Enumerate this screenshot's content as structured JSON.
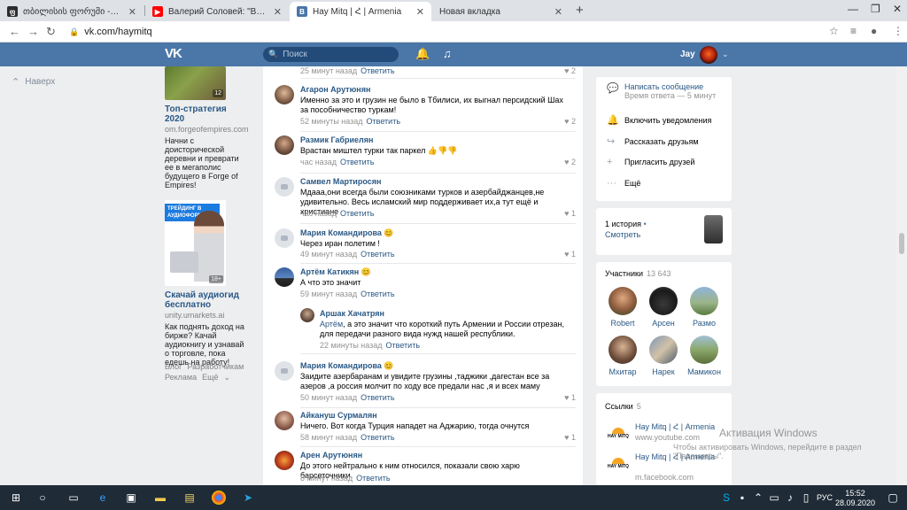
{
  "browser": {
    "tabs": [
      {
        "title": "თბილისის ფორუმი -> Quoti",
        "favicon_color": "#2c2c2c"
      },
      {
        "title": "Валерий Соловей: \"Власть боит",
        "favicon_color": "#ff0000"
      },
      {
        "title": "Hay Mitq | Հ | Armenia",
        "favicon_color": "#4a76a8"
      },
      {
        "title": "Новая вкладка",
        "favicon_color": "#ffffff"
      }
    ],
    "url": "vk.com/haymitq"
  },
  "header": {
    "search_placeholder": "Поиск",
    "username": "Jay"
  },
  "left": {
    "back_label": "Наверх"
  },
  "ads": [
    {
      "badge": "12",
      "title": "Топ-стратегия 2020",
      "domain": "om.forgeofempires.com",
      "desc": "Начни с доисторической деревни и преврати ее в мегаполис будущего в Forge of Empires!"
    },
    {
      "banner": "ТРЕЙДИНГ В АУДИОФОРМАТЕ",
      "badge": "18+",
      "title": "Скачай аудиогид бесплатно",
      "domain": "unity.umarkets.ai",
      "desc": "Как поднять доход на бирже? Качай аудиокнигу и узнавай о торговле, пока едешь на работу!"
    }
  ],
  "footer": {
    "blog": "Блог",
    "dev": "Разработчикам",
    "ads": "Реклама",
    "more": "Ещё"
  },
  "comments": [
    {
      "name": "",
      "text": "",
      "time": "25 минут назад",
      "reply": "Ответить",
      "likes": "2"
    },
    {
      "name": "Агарон Арутюнян",
      "text": "Именно за это и грузин не было в Тбилиси, их выгнал персидский Шах за пособничество туркам!",
      "time": "52 минуты назад",
      "reply": "Ответить",
      "likes": "2"
    },
    {
      "name": "Размик Габриелян",
      "text": "Врастан миштел турки так паркел 👍👎👎",
      "time": "час назад",
      "reply": "Ответить",
      "likes": "2"
    },
    {
      "name": "Самвел Мартиросян",
      "text": "Мдааа,они всегда были союзниками турков и азербайджанцев,не удивительно. Весь исламский мир поддерживает их,а тут ещё и христиане",
      "time": "час назад",
      "reply": "Ответить",
      "likes": "1"
    },
    {
      "name": "Мария Командирова 😊",
      "text": "Через иран полетим !",
      "time": "49 минут назад",
      "reply": "Ответить",
      "likes": "1"
    },
    {
      "name": "Артём Катикян 😊",
      "text": "А что это значит",
      "time": "59 минут назад",
      "reply": "Ответить",
      "likes": ""
    },
    {
      "name": "Аршак Хачатрян",
      "mention": "Артём",
      "text": ", а это значит что короткий путь Армении и России отрезан, для передачи разного вида нужд нашей республики.",
      "time": "22 минуты назад",
      "reply": "Ответить",
      "likes": ""
    },
    {
      "name": "Мария Командирова 😊",
      "text": "Заидите азербаранам и увидите грузины ,таджики ,дагестан все за азеров ,а россия молчит по ходу все предали нас ,я и всех маму",
      "time": "50 минут назад",
      "reply": "Ответить",
      "likes": "1"
    },
    {
      "name": "Айкануш Сурмалян",
      "text": "Ничего. Вот когда Турция нападет на Аджарию, тогда очнутся",
      "time": "58 минут назад",
      "reply": "Ответить",
      "likes": "1"
    },
    {
      "name": "Арен Арутюнян",
      "text": "До этого нейтрально к ним относился, показали свою харю барсеточники.",
      "time": "8 минут назад",
      "reply": "Ответить",
      "likes": ""
    }
  ],
  "right": {
    "message": "Написать сообщение",
    "response": "Время ответа — 5 минут",
    "notify": "Включить уведомления",
    "share": "Рассказать друзьям",
    "invite": "Пригласить друзей",
    "more": "Ещё",
    "story_count": "1 история",
    "story_watch": "Смотреть",
    "members_title": "Участники",
    "members_count": "13 643",
    "members": [
      "Robert",
      "Арсен",
      "Размо",
      "Мхитар",
      "Нарек",
      "Мамикон"
    ],
    "links_title": "Ссылки",
    "links_count": "5",
    "links": [
      {
        "name": "Hay Mitq | Հ | Armenia",
        "url": "www.youtube.com"
      },
      {
        "name": "Hay Mitq | Հ | Armenia",
        "url": "m.facebook.com"
      }
    ]
  },
  "watermark": {
    "title": "Активация Windows",
    "sub": "Чтобы активировать Windows, перейдите в раздел \"Параметры\"."
  },
  "taskbar": {
    "time": "15:52",
    "date": "28.09.2020",
    "lang": "РУС"
  }
}
